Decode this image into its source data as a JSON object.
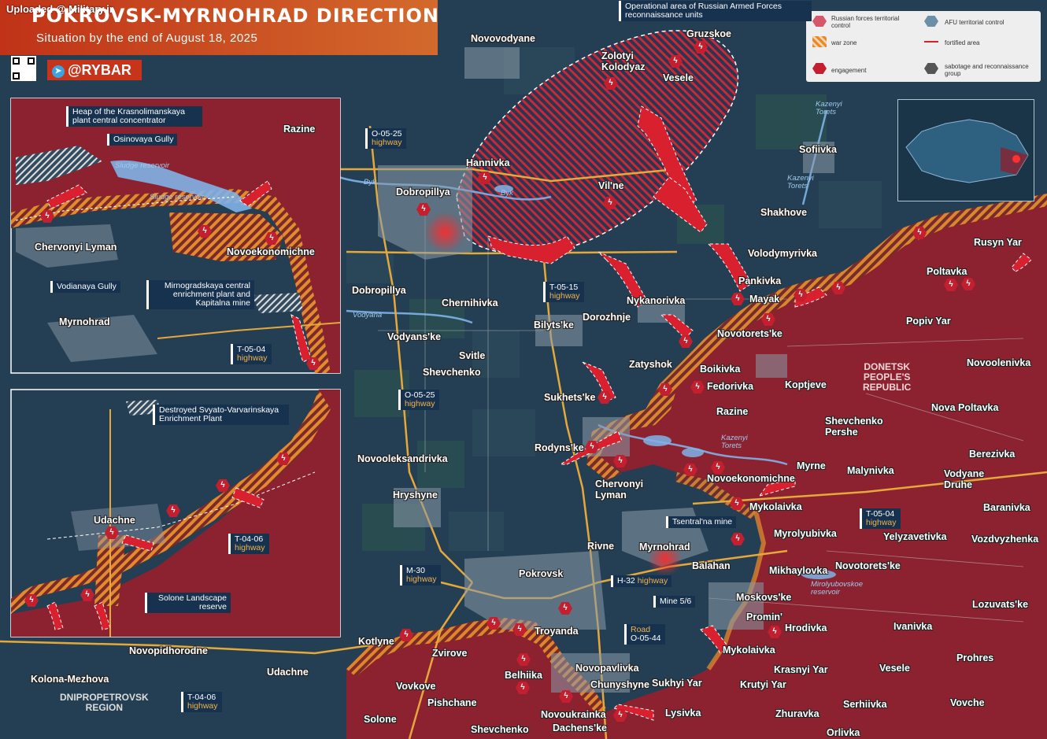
{
  "header": {
    "uploaded": "Uploaded @ Military.ir",
    "title": "POKROVSK-MYRNOHRAD DIRECTION",
    "subtitle": "Situation by the end of August 18, 2025",
    "brand": "@RYBAR"
  },
  "legend": {
    "items": [
      {
        "id": "russian",
        "label": "Russian forces territorial control"
      },
      {
        "id": "afu",
        "label": "AFU territorial control"
      },
      {
        "id": "warzone",
        "label": "war zone"
      },
      {
        "id": "fortified",
        "label": "fortified area"
      },
      {
        "id": "engagement",
        "label": "engagement"
      },
      {
        "id": "sabotage",
        "label": "sabotage and reconnaissance group"
      }
    ]
  },
  "colors": {
    "russian": "#8c2230",
    "afu": "#253f52",
    "warzone": "#e38a2c",
    "engagement": "#c41f2e",
    "arrow": "#d9202e",
    "road": "#e5a83a",
    "water": "#7fb3e8",
    "town": "#8a9aa8"
  },
  "callouts": {
    "operational": "Operational area of Russian Armed Forces reconnaissance units",
    "tsentralna": "Tsentral'na mine",
    "mine56": "Mine 5/6"
  },
  "roads": {
    "o0525a": {
      "code": "O-05-25",
      "type": "highway"
    },
    "o0525b": {
      "code": "O-05-25",
      "type": "highway"
    },
    "t0515": {
      "code": "T-05-15",
      "type": "highway"
    },
    "t0504": {
      "code": "T-05-04",
      "type": "highway"
    },
    "m30": {
      "code": "M-30",
      "type": "highway"
    },
    "h32": {
      "code": "H-32",
      "type": "highway"
    },
    "o0544": {
      "code": "Road",
      "type": "O-05-44"
    },
    "t0406": {
      "code": "T-04-06",
      "type": "highway"
    },
    "ins1_t0504": {
      "code": "T-05-04",
      "type": "highway"
    },
    "ins2_t0406": {
      "code": "T-04-06",
      "type": "highway"
    }
  },
  "regions": {
    "dpr": "DONETSK\nPEOPLE'S\nREPUBLIC",
    "dnipro": "DNIPROPETROVSK\nREGION"
  },
  "rivers": {
    "byk1": "Byk",
    "byk2": "Byk",
    "vodyana": "Vodyana",
    "kazenyi1": "Kazenyi Torets",
    "kazenyi2": "Kazenyi Torets",
    "kazenyi3": "Kazenyi Torets",
    "myrolyub": "Mirolyubovskoe reservoir"
  },
  "settlements": [
    {
      "name": "Gruzskoe"
    },
    {
      "name": "Novovodyane"
    },
    {
      "name": "Zolotyi Kolodyaz"
    },
    {
      "name": "Vesele"
    },
    {
      "name": "Hannivka"
    },
    {
      "name": "Dobropillya"
    },
    {
      "name": "Vil'ne"
    },
    {
      "name": "Sofiivka"
    },
    {
      "name": "Shakhove"
    },
    {
      "name": "Volodymyrivka"
    },
    {
      "name": "Rusyn Yar"
    },
    {
      "name": "Pankivka"
    },
    {
      "name": "Mayak"
    },
    {
      "name": "Poltavka"
    },
    {
      "name": "Popiv Yar"
    },
    {
      "name": "Dobropillya"
    },
    {
      "name": "Chernihivka"
    },
    {
      "name": "Nykanorivka"
    },
    {
      "name": "Dorozhnje"
    },
    {
      "name": "Bilyts'ke"
    },
    {
      "name": "Vodyans'ke"
    },
    {
      "name": "Svitle"
    },
    {
      "name": "Novotorets'ke"
    },
    {
      "name": "Zatyshok"
    },
    {
      "name": "Boikivka"
    },
    {
      "name": "Shevchenko"
    },
    {
      "name": "Novoolenivka"
    },
    {
      "name": "Fedorivka"
    },
    {
      "name": "Koptjeve"
    },
    {
      "name": "Sukhets'ke"
    },
    {
      "name": "Razine"
    },
    {
      "name": "Nova Poltavka"
    },
    {
      "name": "Shevchenko Pershe"
    },
    {
      "name": "Rodyns'ke"
    },
    {
      "name": "Novooleksandrivka"
    },
    {
      "name": "Chervonyi Lyman"
    },
    {
      "name": "Novoekonomichne"
    },
    {
      "name": "Myrne"
    },
    {
      "name": "Malynivka"
    },
    {
      "name": "Berezivka"
    },
    {
      "name": "Hryshyne"
    },
    {
      "name": "Vodyane Druhe"
    },
    {
      "name": "Mykolaivka"
    },
    {
      "name": "Baranivka"
    },
    {
      "name": "Myrolyubivka"
    },
    {
      "name": "Yelyzavetivka"
    },
    {
      "name": "Vozdvyzhenka"
    },
    {
      "name": "Rivne"
    },
    {
      "name": "Myrnohrad"
    },
    {
      "name": "Balahan"
    },
    {
      "name": "Pokrovsk"
    },
    {
      "name": "Mikhaylovka"
    },
    {
      "name": "Novotorets'ke"
    },
    {
      "name": "Moskovs'ke"
    },
    {
      "name": "Promin'"
    },
    {
      "name": "Lozuvats'ke"
    },
    {
      "name": "Troyanda"
    },
    {
      "name": "Hrodivka"
    },
    {
      "name": "Ivanivka"
    },
    {
      "name": "Kotlyne"
    },
    {
      "name": "Zvirove"
    },
    {
      "name": "Mykolaivka"
    },
    {
      "name": "Prohres"
    },
    {
      "name": "Novopidhorodne"
    },
    {
      "name": "Novopavlivka"
    },
    {
      "name": "Krasnyi Yar"
    },
    {
      "name": "Vesele"
    },
    {
      "name": "Belhiika"
    },
    {
      "name": "Udachne"
    },
    {
      "name": "Kolona-Mezhova"
    },
    {
      "name": "Chunyshyne"
    },
    {
      "name": "Sukhyi Yar"
    },
    {
      "name": "Krutyi Yar"
    },
    {
      "name": "Vovkove"
    },
    {
      "name": "Pishchane"
    },
    {
      "name": "Serhiivka"
    },
    {
      "name": "Vovche"
    },
    {
      "name": "Novoukrainka"
    },
    {
      "name": "Lysivka"
    },
    {
      "name": "Zhuravka"
    },
    {
      "name": "Solone"
    },
    {
      "name": "Shevchenko"
    },
    {
      "name": "Dachens'ke"
    },
    {
      "name": "Orlivka"
    }
  ],
  "inset1": {
    "razine": "Razine",
    "heap": "Heap of the Krasnolimanskaya plant central concentrator",
    "osinovaya": "Osinovaya Gully",
    "sludge1": "Sludge reservoir",
    "sludge2": "Sludge reservoir",
    "chervonyi": "Chervonyi Lyman",
    "novoek": "Novoekonomichne",
    "vodianaya": "Vodianaya Gully",
    "mirno": "Mirnogradskaya central enrichment plant and Kapitalna mine",
    "myrnohrad": "Myrnohrad"
  },
  "inset2": {
    "destroyed": "Destroyed Svyato-Varvarinskaya Enrichment Plant",
    "udachne": "Udachne",
    "solone": "Solone Landscape reserve"
  }
}
